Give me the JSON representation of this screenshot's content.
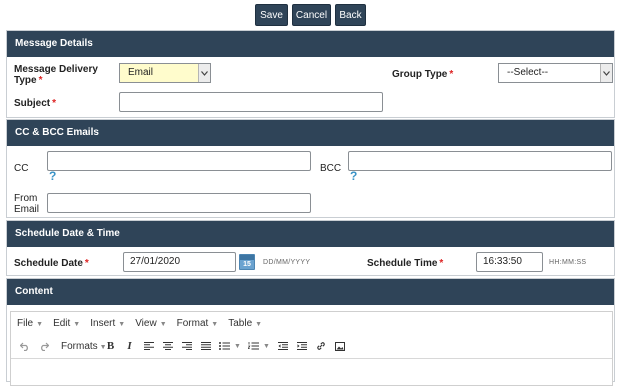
{
  "actions": {
    "save": "Save",
    "cancel": "Cancel",
    "back": "Back"
  },
  "message_details": {
    "heading": "Message Details",
    "delivery_label_line1": "Message Delivery",
    "delivery_label_line2": "Type",
    "delivery_value": "Email",
    "group_type_label": "Group Type",
    "group_type_value": "--Select--",
    "subject_label": "Subject",
    "subject_value": ""
  },
  "cc_bcc": {
    "heading": "CC & BCC Emails",
    "cc_label": "CC",
    "bcc_label": "BCC",
    "help": "?",
    "from_label_line1": "From",
    "from_label_line2": "Email",
    "cc_value": "",
    "bcc_value": "",
    "from_value": ""
  },
  "schedule": {
    "heading": "Schedule Date & Time",
    "date_label": "Schedule Date",
    "date_value": "27/01/2020",
    "date_hint": "DD/MM/YYYY",
    "calendar_day": "15",
    "time_label": "Schedule Time",
    "time_value": "16:33:50",
    "time_hint": "HH:MM:SS"
  },
  "content": {
    "heading": "Content",
    "menus": [
      "File",
      "Edit",
      "Insert",
      "View",
      "Format",
      "Table"
    ],
    "formats_label": "Formats"
  },
  "required_mark": "*",
  "colors": {
    "header": "#2f4458",
    "required": "#dd2222",
    "help": "#3a93c7",
    "highlight_select": "#fffccc"
  }
}
